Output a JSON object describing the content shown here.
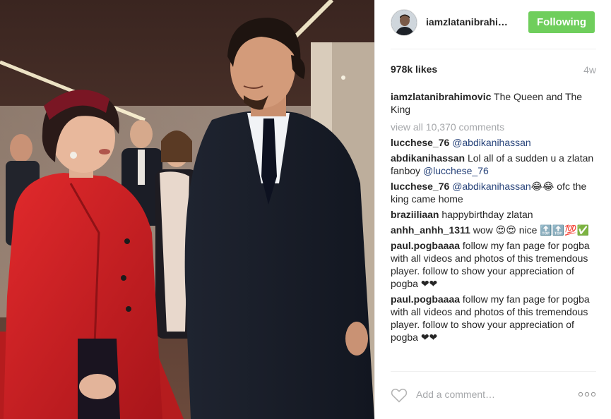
{
  "post": {
    "author": {
      "username": "iamzlatanibrahi…",
      "follow_label": "Following"
    },
    "likes": "978k likes",
    "time_ago": "4w",
    "caption": {
      "user": "iamzlatanibrahimovic",
      "text": "The Queen and The King"
    },
    "view_all": "view all 10,370 comments",
    "comments": [
      {
        "user": "lucchese_76",
        "parts": [
          {
            "mention": "@abdikanihassan"
          }
        ]
      },
      {
        "user": "abdikanihassan",
        "parts": [
          {
            "text": "Lol all of a sudden u a zlatan fanboy "
          },
          {
            "mention": "@lucchese_76"
          }
        ]
      },
      {
        "user": "lucchese_76",
        "parts": [
          {
            "mention": "@abdikanihassan"
          },
          {
            "text": "😂😂 ofc the king came home"
          }
        ]
      },
      {
        "user": "braziiliaan",
        "parts": [
          {
            "text": "happybirthday zlatan"
          }
        ]
      },
      {
        "user": "anhh_anhh_1311",
        "parts": [
          {
            "text": "wow 😍😍 nice 🔝🔝💯✅"
          }
        ]
      },
      {
        "user": "paul.pogbaaaa",
        "parts": [
          {
            "text": "follow my fan page for pogba with all videos and photos of this tremendous player. follow to show your appreciation of pogba ❤❤"
          }
        ]
      },
      {
        "user": "paul.pogbaaaa",
        "parts": [
          {
            "text": "follow my fan page for pogba with all videos and photos of this tremendous player. follow to show your appreciation of pogba ❤❤"
          }
        ]
      }
    ],
    "add_comment_placeholder": "Add a comment…",
    "icons": {
      "like": "heart-outline-icon",
      "more": "more-options-icon"
    },
    "colors": {
      "follow_button": "#6fce5c",
      "mention": "#27437a",
      "muted": "#a5a7aa",
      "coat": "#d8262a"
    }
  }
}
